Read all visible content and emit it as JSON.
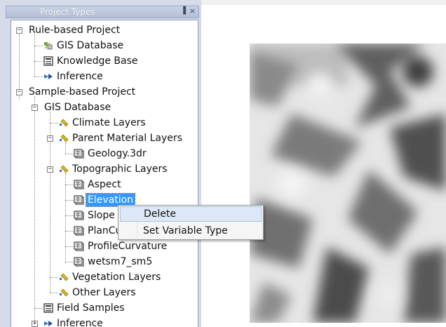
{
  "panel": {
    "title": "Project Types",
    "pin_glyph": "▐",
    "close_glyph": "×"
  },
  "tree": {
    "rule_project": "Rule-based Project",
    "rule_gis": "GIS Database",
    "knowledge_base": "Knowledge Base",
    "rule_inference": "Inference",
    "sample_project": "Sample-based Project",
    "sample_gis": "GIS Database",
    "climate_layers": "Climate Layers",
    "parent_material_layers": "Parent Material Layers",
    "geology": "Geology.3dr",
    "topographic_layers": "Topographic Layers",
    "aspect": "Aspect",
    "elevation": "Elevation",
    "slope": "Slope",
    "plan_curvature": "PlanCu",
    "profile_curvature": "ProfileCurvature",
    "wetsm": "wetsm7_sm5",
    "vegetation_layers": "Vegetation Layers",
    "other_layers": "Other Layers",
    "field_samples": "Field Samples",
    "sample_inference": "Inference"
  },
  "context_menu": {
    "delete": "Delete",
    "set_variable_type": "Set Variable Type"
  }
}
